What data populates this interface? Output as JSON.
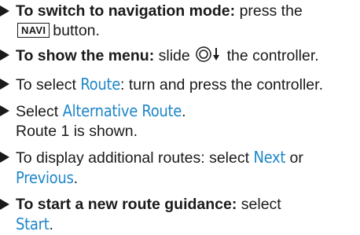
{
  "steps": [
    {
      "bold_label": "To switch to navigation mode:",
      "text_before_key": "press the",
      "key_label": "NAVI",
      "text_after_key": "button."
    },
    {
      "bold_label": "To show the menu:",
      "text_before_icon": "slide",
      "controller_icon": "controller-slide-down-icon",
      "text_after_icon": "the controller."
    },
    {
      "text_before": "To select",
      "term": "Route",
      "text_after": ": turn and press the controller."
    },
    {
      "text_before": "Select",
      "term": "Alternative Route",
      "text_after": ".",
      "line2": "Route 1 is shown."
    },
    {
      "text_before": "To display additional routes: select",
      "term1": "Next",
      "text_mid": "or",
      "term2": "Previous",
      "text_after": "."
    },
    {
      "bold_label": "To start a new route guidance:",
      "text_before": "select",
      "term": "Start",
      "text_after": "."
    }
  ],
  "colors": {
    "text": "#1a1a1a",
    "term": "#1e86c8"
  }
}
